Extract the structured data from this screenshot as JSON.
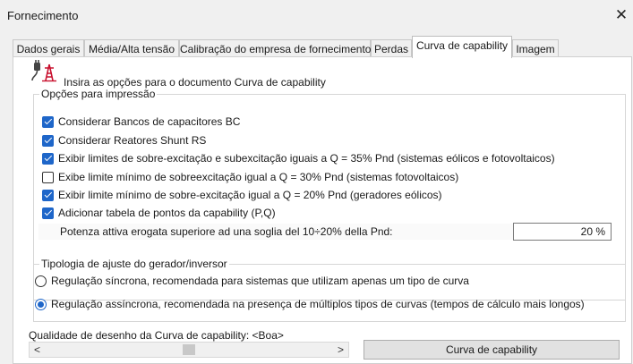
{
  "window": {
    "title": "Fornecimento",
    "close_glyph": "✕"
  },
  "tabs": [
    {
      "label": "Dados gerais"
    },
    {
      "label": "Média/Alta tensão"
    },
    {
      "label": "Calibração do empresa de fornecimento"
    },
    {
      "label": "Perdas"
    },
    {
      "label": "Curva de capability",
      "active": true
    },
    {
      "label": "Imagem"
    }
  ],
  "header": {
    "icon": "plug-tower-icon",
    "text": "Insira as opções para o documento Curva de capability"
  },
  "print_options": {
    "legend": "Opções para impressão",
    "items": [
      {
        "label": "Considerar Bancos de capacitores BC",
        "checked": true
      },
      {
        "label": "Considerar Reatores Shunt RS",
        "checked": true
      },
      {
        "label": "Exibir limites de sobre-excitação e subexcitação iguais a Q = 35% Pnd (sistemas eólicos e fotovoltaicos)",
        "checked": true
      },
      {
        "label": "Exibe limite mínimo de sobreexcitação igual a Q = 30% Pnd (sistemas fotovoltaicos)",
        "checked": false
      },
      {
        "label": "Exibir limite mínimo de sobre-excitação igual a Q = 20% Pnd (geradores eólicos)",
        "checked": true
      },
      {
        "label": "Adicionar tabela de pontos da capability (P,Q)",
        "checked": true
      }
    ],
    "pnd_label": "Potenza attiva erogata superiore ad una soglia del 10÷20% della Pnd:",
    "pnd_value": "20 %"
  },
  "regulation": {
    "legend": "Tipologia de ajuste do gerador/inversor",
    "options": [
      {
        "label": "Regulação síncrona, recomendada para sistemas que utilizam apenas um tipo de curva",
        "selected": false
      },
      {
        "label": "Regulação assíncrona, recomendada na presença de múltiplos tipos de curvas (tempos de cálculo mais longos)",
        "selected": true
      }
    ]
  },
  "quality": {
    "label": "Qualidade de desenho da Curva de capability: <Boa>",
    "left_arrow": "<",
    "right_arrow": ">",
    "level": 0.5
  },
  "curve_button": "Curva de capability"
}
